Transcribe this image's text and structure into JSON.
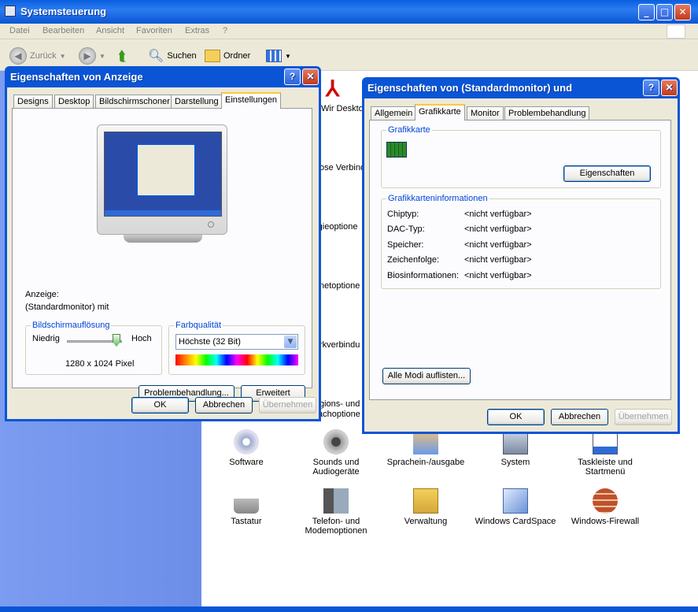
{
  "main_window": {
    "title": "Systemsteuerung",
    "menu": [
      "Datei",
      "Bearbeiten",
      "Ansicht",
      "Favoriten",
      "Extras",
      "?"
    ],
    "toolbar": {
      "back": "Zurück",
      "search": "Suchen",
      "folders": "Ordner"
    },
    "partial_labels": [
      "Wir Desktop",
      "ose Verbind",
      "rgieoptione",
      "netoptione",
      "rkverbindu",
      "gions- und",
      "achoptione"
    ],
    "items": [
      {
        "label": "Software",
        "icon": "software-icon"
      },
      {
        "label": "Sounds und Audiogeräte",
        "icon": "speaker-icon"
      },
      {
        "label": "Sprachein-/ausgabe",
        "icon": "speech-icon"
      },
      {
        "label": "System",
        "icon": "system-icon"
      },
      {
        "label": "Taskleiste und Startmenü",
        "icon": "taskbar-icon"
      },
      {
        "label": "Tastatur",
        "icon": "keyboard-icon"
      },
      {
        "label": "Telefon- und Modemoptionen",
        "icon": "phone-icon"
      },
      {
        "label": "Verwaltung",
        "icon": "admin-tools-icon"
      },
      {
        "label": "Windows CardSpace",
        "icon": "cardspace-icon"
      },
      {
        "label": "Windows-Firewall",
        "icon": "firewall-icon"
      }
    ]
  },
  "display_dialog": {
    "title": "Eigenschaften von Anzeige",
    "tabs": [
      "Designs",
      "Desktop",
      "Bildschirmschoner",
      "Darstellung",
      "Einstellungen"
    ],
    "active_tab": "Einstellungen",
    "display_label": "Anzeige:",
    "display_value": "(Standardmonitor) mit",
    "resolution_group": "Bildschirmauflösung",
    "res_low": "Niedrig",
    "res_high": "Hoch",
    "res_value": "1280 x 1024 Pixel",
    "color_group": "Farbqualität",
    "color_value": "Höchste (32 Bit)",
    "troubleshoot_button": "Problembehandlung...",
    "advanced_button": "Erweitert",
    "ok": "OK",
    "cancel": "Abbrechen",
    "apply": "Übernehmen"
  },
  "monitor_dialog": {
    "title": "Eigenschaften von (Standardmonitor) und",
    "tabs": [
      "Allgemein",
      "Grafikkarte",
      "Monitor",
      "Problembehandlung"
    ],
    "active_tab": "Grafikkarte",
    "adapter_group": "Grafikkarte",
    "properties_button": "Eigenschaften",
    "info_group": "Grafikkarteninformationen",
    "info_rows": [
      {
        "label": "Chiptyp:",
        "value": "<nicht verfügbar>"
      },
      {
        "label": "DAC-Typ:",
        "value": "<nicht verfügbar>"
      },
      {
        "label": "Speicher:",
        "value": "<nicht verfügbar>"
      },
      {
        "label": "Zeichenfolge:",
        "value": "<nicht verfügbar>"
      },
      {
        "label": "Biosinformationen:",
        "value": "<nicht verfügbar>"
      }
    ],
    "list_modes_button": "Alle Modi auflisten...",
    "ok": "OK",
    "cancel": "Abbrechen",
    "apply": "Übernehmen"
  },
  "colors": {
    "title_blue": "#0a55d6",
    "face": "#ece9d8",
    "accent_tab": "#ffc73c"
  }
}
